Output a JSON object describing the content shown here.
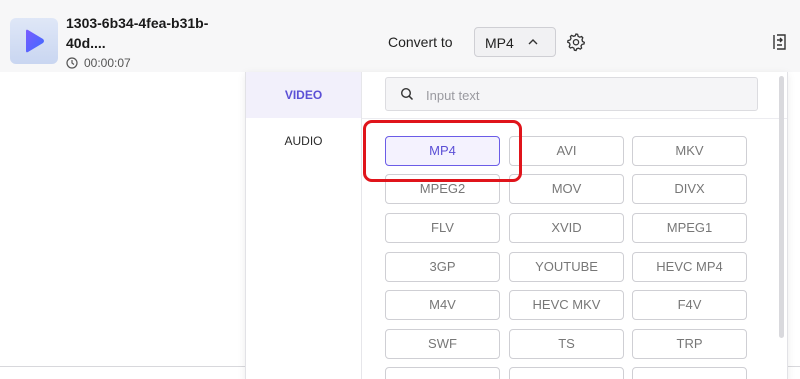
{
  "file": {
    "name": "1303-6b34-4fea-b31b-40d....",
    "duration": "00:00:07"
  },
  "toolbar": {
    "convert_label": "Convert to",
    "selected_format": "MP4"
  },
  "icons": {
    "thumbnail": "play-icon",
    "duration": "clock-icon",
    "select": "chevron-up-icon",
    "settings": "gear-icon",
    "right": "export-icon",
    "search": "search-icon"
  },
  "colors": {
    "accent": "#5b4fd6",
    "highlight_box": "#e0141b"
  },
  "dropdown": {
    "categories": [
      {
        "label": "VIDEO",
        "active": true
      },
      {
        "label": "AUDIO",
        "active": false
      }
    ],
    "search": {
      "placeholder": "Input text"
    },
    "formats": [
      [
        "MP4",
        "AVI",
        "MKV"
      ],
      [
        "MPEG2",
        "MOV",
        "DIVX"
      ],
      [
        "FLV",
        "XVID",
        "MPEG1"
      ],
      [
        "3GP",
        "YOUTUBE",
        "HEVC MP4"
      ],
      [
        "M4V",
        "HEVC MKV",
        "F4V"
      ],
      [
        "SWF",
        "TS",
        "TRP"
      ]
    ],
    "selected": "MP4"
  }
}
